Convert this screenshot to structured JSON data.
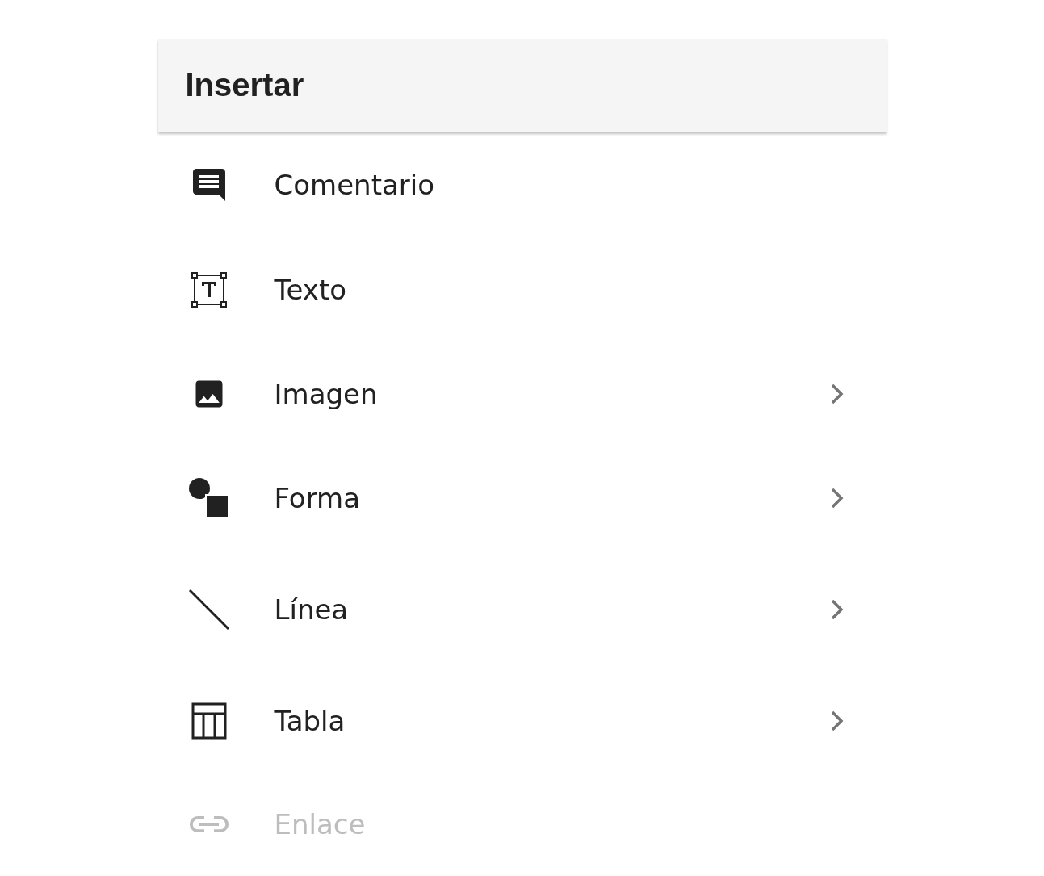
{
  "menu": {
    "title": "Insertar",
    "items": [
      {
        "label": "Comentario",
        "submenu": false,
        "disabled": false
      },
      {
        "label": "Texto",
        "submenu": false,
        "disabled": false
      },
      {
        "label": "Imagen",
        "submenu": true,
        "disabled": false
      },
      {
        "label": "Forma",
        "submenu": true,
        "disabled": false
      },
      {
        "label": "Línea",
        "submenu": true,
        "disabled": false
      },
      {
        "label": "Tabla",
        "submenu": true,
        "disabled": false
      },
      {
        "label": "Enlace",
        "submenu": false,
        "disabled": true
      }
    ]
  }
}
